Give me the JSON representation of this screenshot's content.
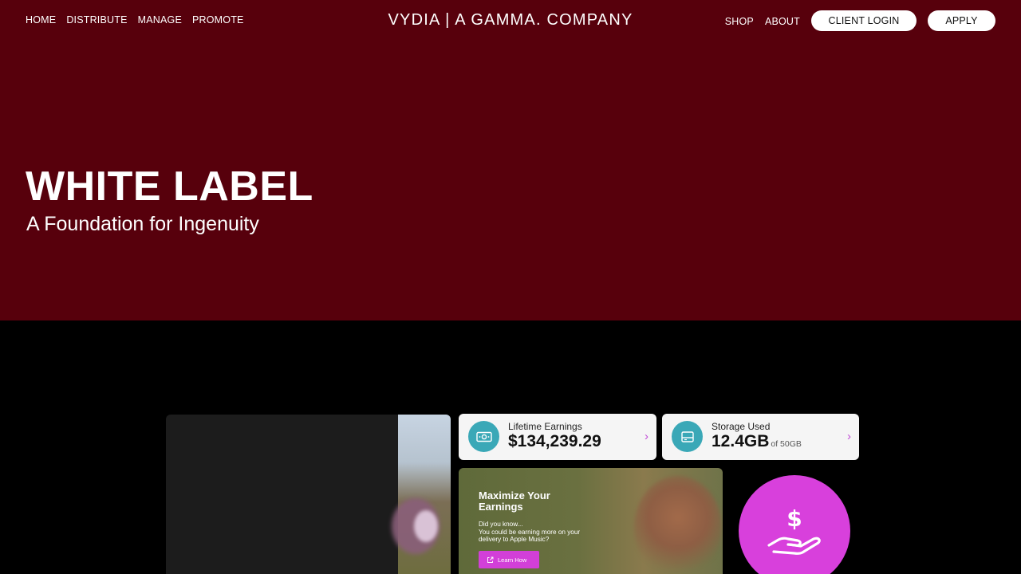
{
  "nav": {
    "left_links": [
      "HOME",
      "DISTRIBUTE",
      "MANAGE",
      "PROMOTE"
    ],
    "logo": "VYDIA | A GAMMA. COMPANY",
    "right_links": [
      "SHOP",
      "ABOUT"
    ],
    "client_login": "CLIENT LOGIN",
    "apply": "APPLY"
  },
  "hero": {
    "title": "WHITE LABEL",
    "subtitle": "A Foundation for Ingenuity",
    "background": "#57000c"
  },
  "dashboard": {
    "earnings_card": {
      "label": "Lifetime Earnings",
      "value": "$134,239.29",
      "icon": "money-icon"
    },
    "storage_card": {
      "label": "Storage Used",
      "value": "12.4GB",
      "value_suffix": "of 50GB",
      "icon": "drive-icon"
    },
    "promo": {
      "title_line1": "Maximize Your",
      "title_line2": "Earnings",
      "text_line1": "Did you know...",
      "text_line2": "You could be earning more on your",
      "text_line3": "delivery to Apple Music?",
      "button": "Learn How"
    },
    "accent_color": "#d840dc",
    "teal_color": "#3aa8b7"
  }
}
